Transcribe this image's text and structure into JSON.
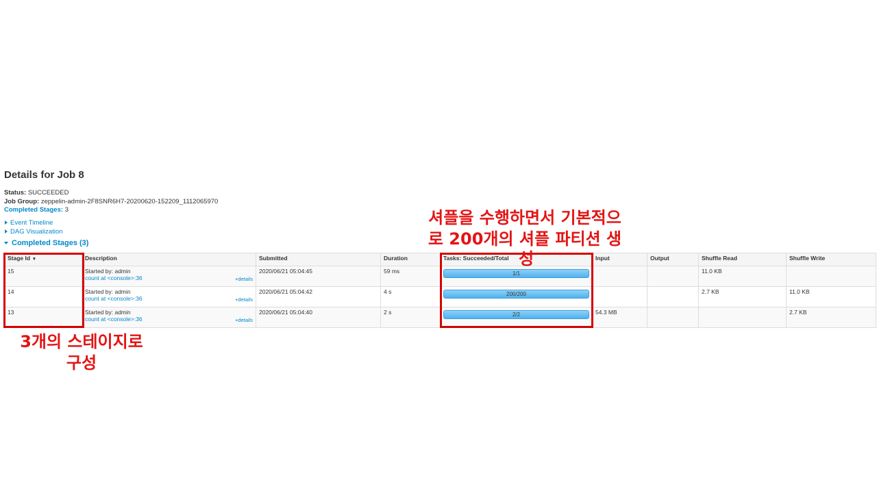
{
  "page": {
    "title": "Details for Job 8"
  },
  "summary": {
    "status_label": "Status:",
    "status_value": "SUCCEEDED",
    "job_group_label": "Job Group:",
    "job_group_value": "zeppelin-admin-2F8SNR6H7-20200620-152209_1112065970",
    "completed_stages_label": "Completed Stages:",
    "completed_stages_value": "3"
  },
  "toggles": {
    "event_timeline": "Event Timeline",
    "dag_visualization": "DAG Visualization"
  },
  "section": {
    "title": "Completed Stages (3)"
  },
  "table": {
    "headers": [
      "Stage Id",
      "Description",
      "Submitted",
      "Duration",
      "Tasks: Succeeded/Total",
      "Input",
      "Output",
      "Shuffle Read",
      "Shuffle Write"
    ],
    "sort_indicator": "▾",
    "rows": [
      {
        "stage_id": "15",
        "started_by": "Started by: admin",
        "desc_link": "count at <console>:36",
        "details": "+details",
        "submitted": "2020/06/21 05:04:45",
        "duration": "59 ms",
        "tasks": "1/1",
        "tasks_fraction": 1.0,
        "input": "",
        "output": "",
        "shuffle_read": "11.0 KB",
        "shuffle_write": ""
      },
      {
        "stage_id": "14",
        "started_by": "Started by: admin",
        "desc_link": "count at <console>:36",
        "details": "+details",
        "submitted": "2020/06/21 05:04:42",
        "duration": "4 s",
        "tasks": "200/200",
        "tasks_fraction": 1.0,
        "input": "",
        "output": "",
        "shuffle_read": "2.7 KB",
        "shuffle_write": "11.0 KB"
      },
      {
        "stage_id": "13",
        "started_by": "Started by: admin",
        "desc_link": "count at <console>:36",
        "details": "+details",
        "submitted": "2020/06/21 05:04:40",
        "duration": "2 s",
        "tasks": "2/2",
        "tasks_fraction": 1.0,
        "input": "54.3 MB",
        "output": "",
        "shuffle_read": "",
        "shuffle_write": "2.7 KB"
      }
    ]
  },
  "annotations": {
    "shuffle_note_line1": "셔플을 수행하면서 기본적으",
    "shuffle_note_line2": "로 200개의 셔플 파티션 생",
    "shuffle_note_line3": "성",
    "stages_note_line1": "3개의 스테이지로",
    "stages_note_line2": "구성",
    "highlight_color": "#d50000",
    "text_color": "#e31414"
  }
}
